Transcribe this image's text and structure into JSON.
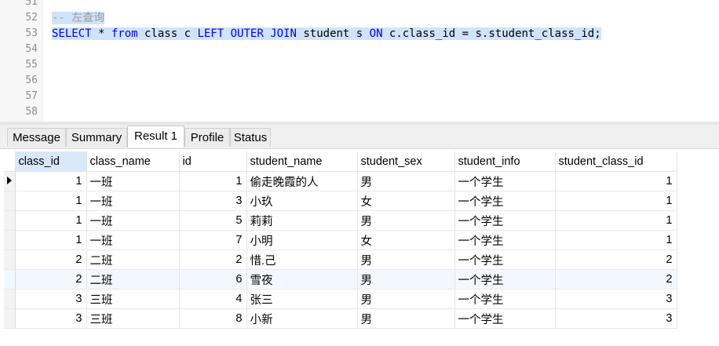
{
  "editor": {
    "lines": [
      {
        "num": "51",
        "text": ""
      },
      {
        "num": "52",
        "comment": "-- 左查询"
      },
      {
        "num": "53",
        "tokens": [
          {
            "t": "SELECT",
            "c": "kw"
          },
          {
            "t": " * ",
            "c": "id"
          },
          {
            "t": "from",
            "c": "kw"
          },
          {
            "t": " class c ",
            "c": "id"
          },
          {
            "t": "LEFT",
            "c": "kw"
          },
          {
            "t": " ",
            "c": "id"
          },
          {
            "t": "OUTER",
            "c": "kw"
          },
          {
            "t": " ",
            "c": "id"
          },
          {
            "t": "JOIN",
            "c": "kw"
          },
          {
            "t": " student s ",
            "c": "id"
          },
          {
            "t": "ON",
            "c": "kw"
          },
          {
            "t": " c.class_id = s.student_class_id;",
            "c": "id"
          }
        ]
      },
      {
        "num": "54"
      },
      {
        "num": "55"
      },
      {
        "num": "56"
      },
      {
        "num": "57"
      },
      {
        "num": "58"
      }
    ]
  },
  "tabs": [
    {
      "label": "Message",
      "active": false
    },
    {
      "label": "Summary",
      "active": false
    },
    {
      "label": "Result 1",
      "active": true
    },
    {
      "label": "Profile",
      "active": false
    },
    {
      "label": "Status",
      "active": false
    }
  ],
  "grid": {
    "columns": [
      "class_id",
      "class_name",
      "id",
      "student_name",
      "student_sex",
      "student_info",
      "student_class_id"
    ],
    "sorted_column": "class_id",
    "rows": [
      [
        "1",
        "一班",
        "1",
        "偷走晚霞的人",
        "男",
        "一个学生",
        "1"
      ],
      [
        "1",
        "一班",
        "3",
        "小玖",
        "女",
        "一个学生",
        "1"
      ],
      [
        "1",
        "一班",
        "5",
        "莉莉",
        "男",
        "一个学生",
        "1"
      ],
      [
        "1",
        "一班",
        "7",
        "小明",
        "女",
        "一个学生",
        "1"
      ],
      [
        "2",
        "二班",
        "2",
        "惜.己",
        "男",
        "一个学生",
        "2"
      ],
      [
        "2",
        "二班",
        "6",
        "雪夜",
        "男",
        "一个学生",
        "2"
      ],
      [
        "3",
        "三班",
        "4",
        "张三",
        "男",
        "一个学生",
        "3"
      ],
      [
        "3",
        "三班",
        "8",
        "小新",
        "男",
        "一个学生",
        "3"
      ]
    ],
    "current_row": 0
  }
}
